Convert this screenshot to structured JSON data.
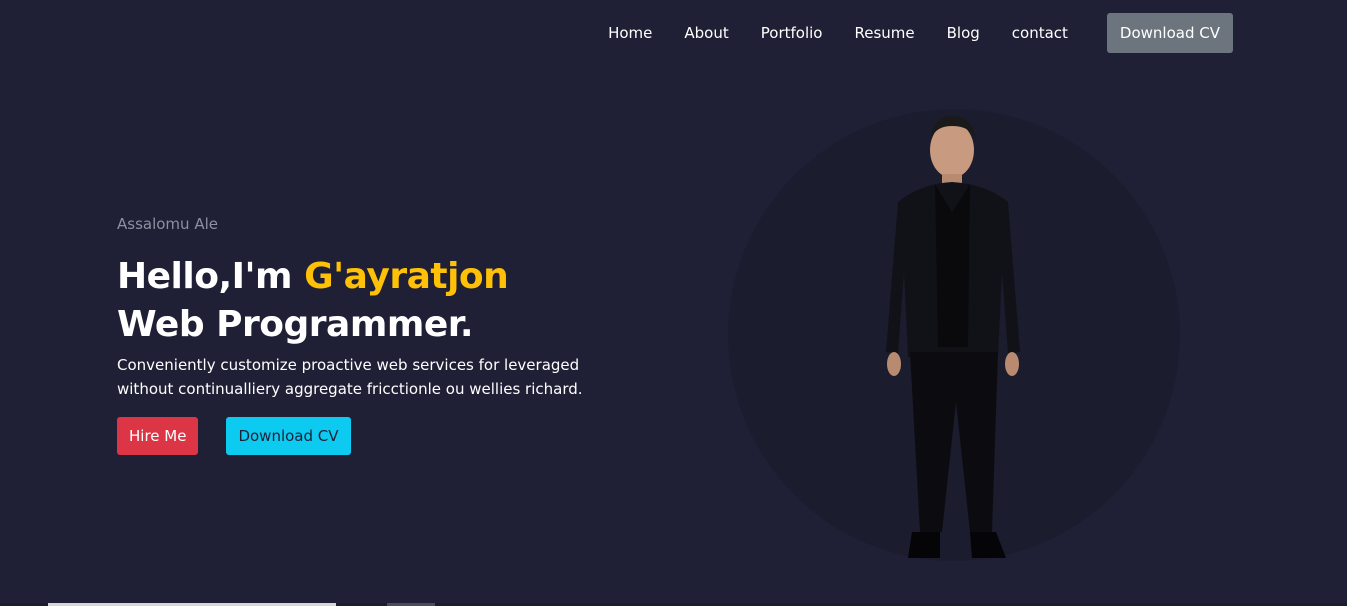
{
  "nav": {
    "items": [
      "Home",
      "About",
      "Portfolio",
      "Resume",
      "Blog",
      "contact"
    ],
    "cta": "Download CV",
    "cta_color": "#6c757d"
  },
  "hero": {
    "greeting": "Assalomu Ale",
    "headline_prefix": "Hello,I'm ",
    "name": "G'ayratjon",
    "role": "Web Programmer.",
    "description": "Conveniently customize proactive web services for leveraged without continualliery aggregate fricctionle ou wellies richard.",
    "hire_button": "Hire Me",
    "download_button": "Download CV"
  },
  "colors": {
    "background": "#1f2035",
    "accent": "#ffc107",
    "hire": "#dc3545",
    "download": "#0dcaf0"
  },
  "image": {
    "subject": "portrait-photo"
  }
}
